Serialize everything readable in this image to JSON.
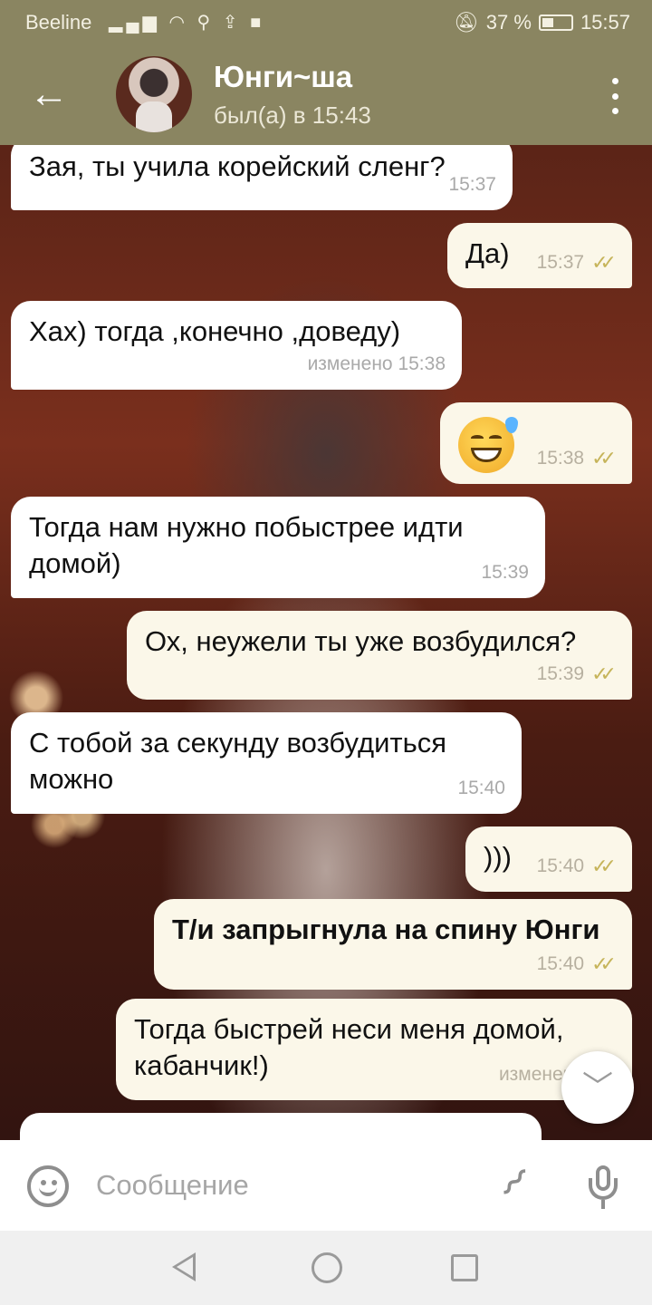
{
  "status_bar": {
    "carrier": "Beeline",
    "battery": "37 %",
    "battery_level": 0.37,
    "time": "15:57"
  },
  "header": {
    "back_icon": "arrow-left-icon",
    "contact_name": "Юнги~ша",
    "last_seen": "был(а) в 15:43",
    "menu_icon": "more-vertical-icon"
  },
  "messages": [
    {
      "direction": "in",
      "text": "Зая, ты учила корейский сленг?",
      "time": "15:37"
    },
    {
      "direction": "out",
      "text": "Да)",
      "time": "15:37",
      "read": true
    },
    {
      "direction": "in",
      "text": "Хах) тогда ,конечно ,доведу)",
      "time": "изменено 15:38"
    },
    {
      "direction": "out",
      "emoji": "smiling-face-with-sweat",
      "time": "15:38",
      "read": true
    },
    {
      "direction": "in",
      "text": "Тогда нам нужно побыстрее идти\nдомой)",
      "time": "15:39"
    },
    {
      "direction": "out",
      "text": "Ох, неужели ты уже возбудился?",
      "time": "15:39",
      "read": true
    },
    {
      "direction": "in",
      "text": "С тобой за секунду возбудиться\nможно",
      "time": "15:40"
    },
    {
      "direction": "out",
      "text": ")))",
      "time": "15:40",
      "read": true
    },
    {
      "direction": "out",
      "text": "Т/и запрыгнула на спину Юнги",
      "time": "15:40",
      "read": true,
      "bold": true
    },
    {
      "direction": "out",
      "text": "Тогда быстрей неси меня домой,\nкабанчик!)",
      "time": "изменено 15:",
      "read": true
    }
  ],
  "input": {
    "placeholder": "Сообщение",
    "emoji_icon": "smile-icon",
    "attach_icon": "paperclip-icon",
    "mic_icon": "microphone-icon"
  },
  "checks": "✓✓",
  "colors": {
    "header": "#8a8561",
    "outgoing_bubble": "#fbf7e9",
    "incoming_bubble": "#ffffff",
    "read_check": "#c6b45a"
  }
}
